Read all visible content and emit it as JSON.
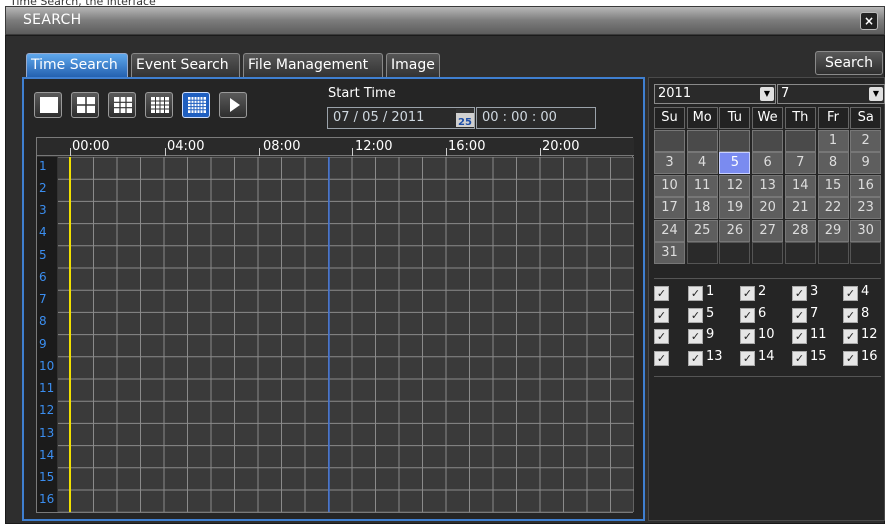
{
  "window": {
    "title": "SEARCH",
    "close_label": "×",
    "top_cut_text": "Time Search, the interface"
  },
  "tabs": [
    {
      "label": "Time Search",
      "active": true
    },
    {
      "label": "Event Search",
      "active": false
    },
    {
      "label": "File Management",
      "active": false
    },
    {
      "label": "Image",
      "active": false
    }
  ],
  "search_button": "Search",
  "view_buttons": [
    {
      "name": "1-split-view-button",
      "icon": "single-window-icon",
      "selected": false
    },
    {
      "name": "4-split-view-button",
      "icon": "grid-2x2-icon",
      "selected": false
    },
    {
      "name": "9-split-view-button",
      "icon": "grid-3x3-icon",
      "selected": false
    },
    {
      "name": "16-split-view-button",
      "icon": "grid-4x4-icon",
      "selected": false
    },
    {
      "name": "multi-split-view-button",
      "icon": "grid-many-icon",
      "selected": true
    },
    {
      "name": "play-button",
      "icon": "play-icon",
      "selected": false
    }
  ],
  "start_time": {
    "label": "Start Time",
    "date": "07 / 05 / 2011",
    "calendar_icon_label": "25",
    "time": "00  :  00  :  00"
  },
  "timeline": {
    "labels": [
      "00:00",
      "04:00",
      "08:00",
      "12:00",
      "16:00",
      "20:00"
    ],
    "channels": [
      "1",
      "2",
      "3",
      "4",
      "5",
      "6",
      "7",
      "8",
      "9",
      "10",
      "11",
      "12",
      "13",
      "14",
      "15",
      "16"
    ]
  },
  "calendar": {
    "year": "2011",
    "month": "7",
    "weekdays": [
      "Su",
      "Mo",
      "Tu",
      "We",
      "Th",
      "Fr",
      "Sa"
    ],
    "weeks": [
      [
        "",
        "",
        "",
        "",
        "",
        "1",
        "2"
      ],
      [
        "3",
        "4",
        "5",
        "6",
        "7",
        "8",
        "9"
      ],
      [
        "10",
        "11",
        "12",
        "13",
        "14",
        "15",
        "16"
      ],
      [
        "17",
        "18",
        "19",
        "20",
        "21",
        "22",
        "23"
      ],
      [
        "24",
        "25",
        "26",
        "27",
        "28",
        "29",
        "30"
      ],
      [
        "31",
        "",
        "",
        "",
        "",
        "",
        ""
      ]
    ],
    "selected_day": "5"
  },
  "channel_checks": {
    "all_label": "",
    "items": [
      {
        "label": "1",
        "checked": true
      },
      {
        "label": "2",
        "checked": true
      },
      {
        "label": "3",
        "checked": true
      },
      {
        "label": "4",
        "checked": true
      },
      {
        "label": "5",
        "checked": true
      },
      {
        "label": "6",
        "checked": true
      },
      {
        "label": "7",
        "checked": true
      },
      {
        "label": "8",
        "checked": true
      },
      {
        "label": "9",
        "checked": true
      },
      {
        "label": "10",
        "checked": true
      },
      {
        "label": "11",
        "checked": true
      },
      {
        "label": "12",
        "checked": true
      },
      {
        "label": "13",
        "checked": true
      },
      {
        "label": "14",
        "checked": true
      },
      {
        "label": "15",
        "checked": true
      },
      {
        "label": "16",
        "checked": true
      }
    ]
  },
  "colors": {
    "accent": "#3f7fd0",
    "active_tab": "#2461b0",
    "cursor_line": "#f0e000",
    "time_marker": "#3b6fd8",
    "channel_label": "#3b8ef0"
  }
}
